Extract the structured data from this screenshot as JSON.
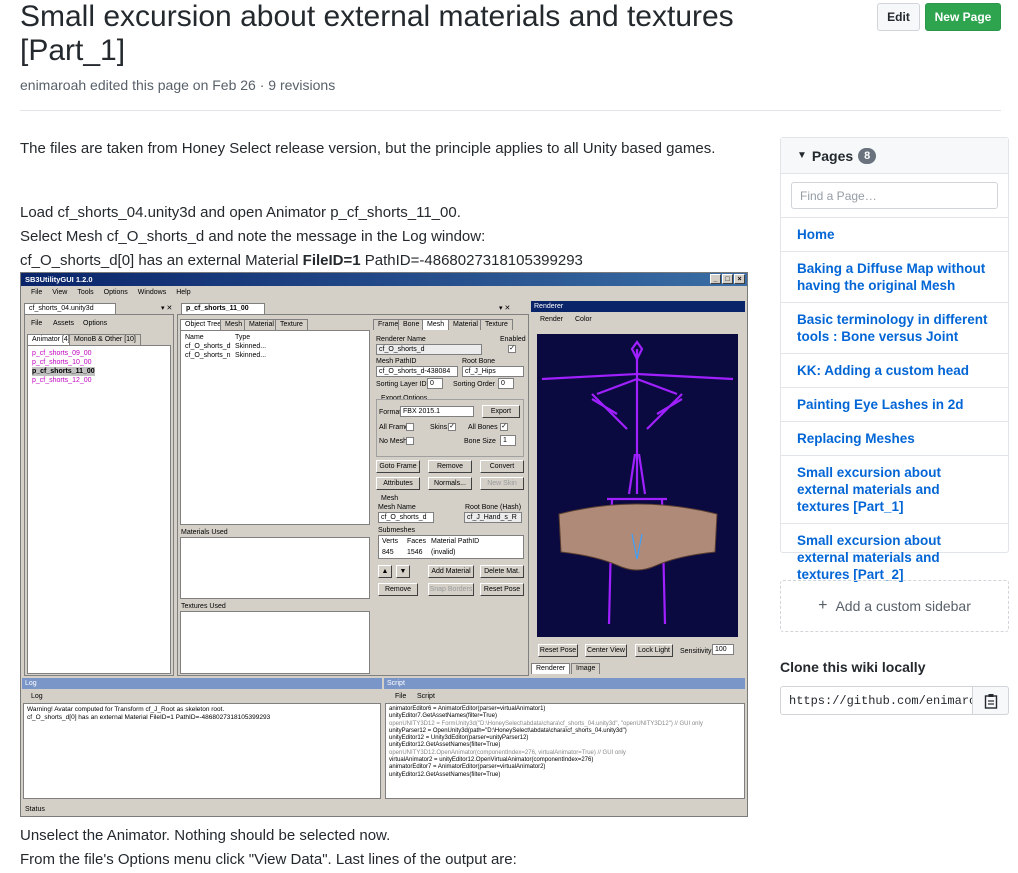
{
  "header": {
    "title": "Small excursion about external materials and textures [Part_1]",
    "meta": "enimaroah edited this page on Feb 26 · 9 revisions",
    "edit_label": "Edit",
    "new_page_label": "New Page"
  },
  "content": {
    "p1": "The files are taken from Honey Select release version, but the principle applies to all Unity based games.",
    "p2_line1": "Load cf_shorts_04.unity3d and open Animator p_cf_shorts_11_00.",
    "p2_line2": "Select Mesh cf_O_shorts_d and note the message in the Log window:",
    "p2_line3_pre": "cf_O_shorts_d[0] has an external Material ",
    "p2_line3_bold": "FileID=1",
    "p2_line3_post": " PathID=-4868027318105399293",
    "p3_line1": "Unselect the Animator. Nothing should be selected now.",
    "p3_line2": "From the file's Options menu click \"View Data\". Last lines of the output are:"
  },
  "sidebar": {
    "pages_label": "Pages",
    "pages_count": "8",
    "find_placeholder": "Find a Page…",
    "pages": [
      "Home",
      "Baking a Diffuse Map without having the original Mesh",
      "Basic terminology in different tools : Bone versus Joint",
      "KK: Adding a custom head",
      "Painting Eye Lashes in 2d",
      "Replacing Meshes",
      "Small excursion about external materials and textures [Part_1]",
      "Small excursion about external materials and textures [Part_2]"
    ],
    "custom_sidebar_label": "Add a custom sidebar",
    "clone_title": "Clone this wiki locally",
    "clone_url": "https://github.com/enimaroa"
  },
  "screenshot": {
    "title": "SB3UtilityGUI 1.2.0",
    "menu": [
      "File",
      "View",
      "Tools",
      "Options",
      "Windows",
      "Help"
    ],
    "file_tab": "cf_shorts_04.unity3d",
    "file_menu": [
      "File",
      "Assets",
      "Options"
    ],
    "file_subtabs": [
      "Animator [4]",
      "MonoB & Other [10]"
    ],
    "animators": [
      "p_cf_shorts_09_00",
      "p_cf_shorts_10_00",
      "p_cf_shorts_11_00",
      "p_cf_shorts_12_00"
    ],
    "editor_tab": "p_cf_shorts_11_00",
    "tree_tabs": [
      "Object Tree",
      "Mesh",
      "Material",
      "Texture"
    ],
    "mesh_cols": [
      "Name",
      "Type"
    ],
    "mesh_rows": [
      [
        "cf_O_shorts_d",
        "Skinned..."
      ],
      [
        "cf_O_shorts_n",
        "Skinned..."
      ]
    ],
    "materials_used": "Materials Used",
    "textures_used": "Textures Used",
    "prop_tabs": [
      "Frame",
      "Bone",
      "Mesh",
      "Material",
      "Texture"
    ],
    "renderer_name_label": "Renderer Name",
    "enabled_label": "Enabled",
    "renderer_name": "cf_O_shorts_d",
    "mesh_pathid_label": "Mesh PathID",
    "root_bone_label": "Root Bone",
    "mesh_pathid": "cf_O_shorts_d-438084",
    "root_bone": "cf_J_Hips",
    "sorting_layer_label": "Sorting Layer ID",
    "sorting_layer": "0",
    "sorting_order_label": "Sorting Order",
    "sorting_order": "0",
    "export_options": "Export Options",
    "format_label": "Format",
    "format": "FBX 2015.1",
    "export_btn": "Export",
    "all_frames": "All Frames",
    "skins": "Skins",
    "all_bones": "All Bones",
    "no_mesh": "No Mesh",
    "bone_size": "Bone Size",
    "bone_size_val": "1",
    "buttons_row1": [
      "Goto Frame",
      "Remove",
      "Convert"
    ],
    "buttons_row2": [
      "Attributes",
      "Normals...",
      "New Skin"
    ],
    "mesh_group": "Mesh",
    "mesh_name_label": "Mesh Name",
    "root_bone_hash_label": "Root Bone (Hash)",
    "mesh_name": "cf_O_shorts_d",
    "root_bone_hash": "cf_J_Hand_s_R",
    "submeshes": "Submeshes",
    "sub_cols": [
      "Verts",
      "Faces",
      "Material PathID"
    ],
    "sub_row": [
      "845",
      "1546",
      "(invalid)"
    ],
    "buttons_row3": [
      "Add Material",
      "Delete Mat."
    ],
    "buttons_row4": [
      "Remove",
      "Snap Borders",
      "Reset Pose"
    ],
    "renderer_title": "Renderer",
    "renderer_menu": [
      "Render",
      "Color"
    ],
    "viewport_buttons": [
      "Reset Pose",
      "Center View",
      "Lock Light"
    ],
    "sensitivity_label": "Sensitivity",
    "sensitivity": "100",
    "bottom_tabs": [
      "Renderer",
      "Image"
    ],
    "log_title": "Log",
    "log_menu": "Log",
    "log_lines": [
      "Warning! Avatar computed for Transform cf_J_Root as skeleton root.",
      "cf_O_shorts_d[0] has an external Material FileID=1 PathID=-4868027318105399293"
    ],
    "script_title": "Script",
    "script_menu": [
      "File",
      "Script"
    ],
    "script_lines": [
      "animatorEditor6 = AnimatorEditor(parser=virtualAnimator1)",
      "unityEditor7.GetAssetNames(filter=True)",
      "openUNITY3D12 = FormUnity3d(\"D:\\HoneySelect\\abdata\\chara\\cf_shorts_04.unity3d\", \"openUNITY3D12\") // GUI only",
      "unityParser12 = OpenUnity3d(path=\"D:\\HoneySelect\\abdata\\chara\\cf_shorts_04.unity3d\")",
      "unityEditor12 = Unity3dEditor(parser=unityParser12)",
      "unityEditor12.GetAssetNames(filter=True)",
      "openUNITY3D12.OpenAnimator(componentIndex=276, virtualAnimator=True) // GUI only",
      "virtualAnimator2 = unityEditor12.OpenVirtualAnimator(componentIndex=276)",
      "animatorEditor7 = AnimatorEditor(parser=virtualAnimator2)",
      "unityEditor12.GetAssetNames(filter=True)"
    ],
    "status": "Status"
  }
}
